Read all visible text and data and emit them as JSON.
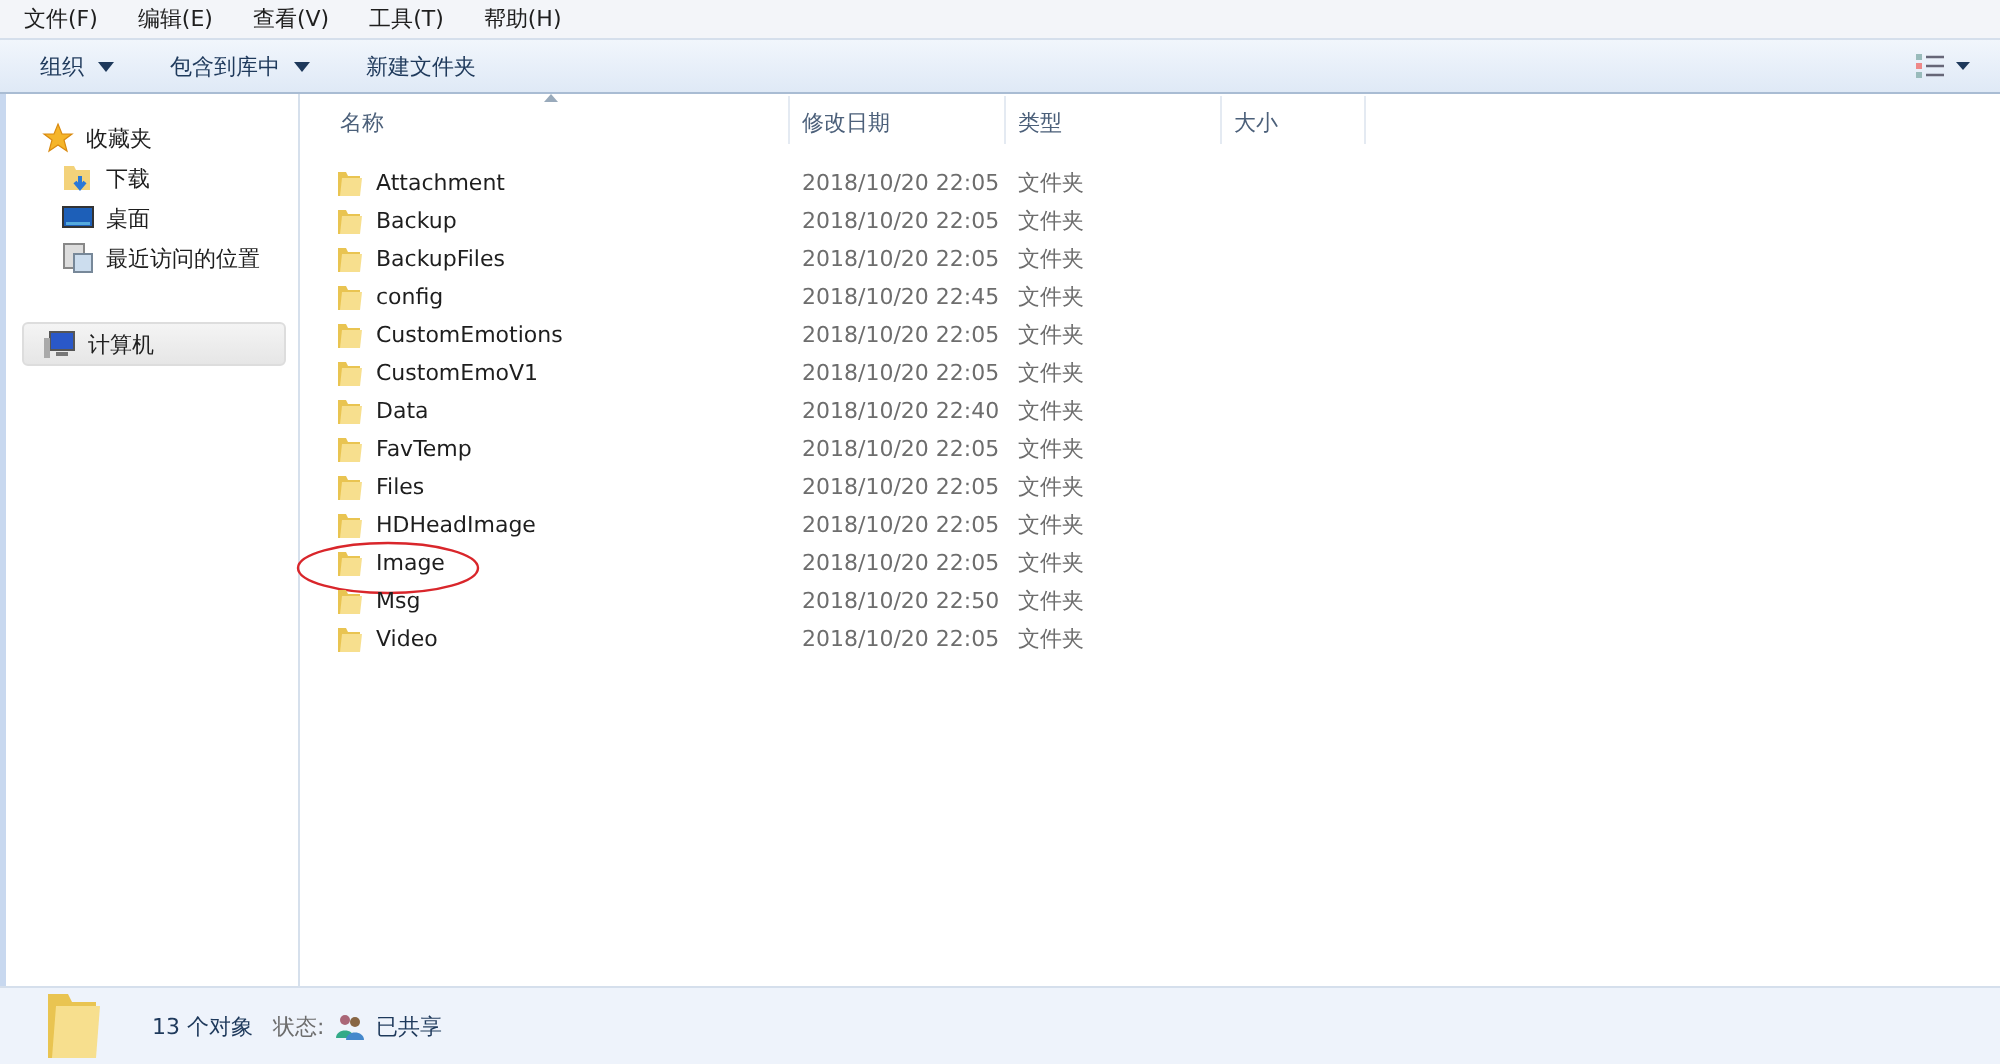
{
  "menu": [
    "文件(F)",
    "编辑(E)",
    "查看(V)",
    "工具(T)",
    "帮助(H)"
  ],
  "toolbar": [
    {
      "label": "组织",
      "dropdown": true
    },
    {
      "label": "包含到库中",
      "dropdown": true
    },
    {
      "label": "新建文件夹",
      "dropdown": false
    }
  ],
  "sidebar": {
    "items": [
      {
        "label": "收藏夹",
        "kind": "favorites",
        "selected": false,
        "children": [
          {
            "label": "下载",
            "kind": "downloads",
            "selected": false
          },
          {
            "label": "桌面",
            "kind": "desktop",
            "selected": false
          },
          {
            "label": "最近访问的位置",
            "kind": "recent",
            "selected": false
          }
        ]
      },
      {
        "label": "计算机",
        "kind": "computer",
        "selected": true
      }
    ]
  },
  "table": {
    "columns": [
      "名称",
      "修改日期",
      "类型",
      "大小"
    ],
    "rows": [
      {
        "name": "Attachment",
        "date": "2018/10/20 22:05",
        "type": "文件夹",
        "circled": false
      },
      {
        "name": "Backup",
        "date": "2018/10/20 22:05",
        "type": "文件夹",
        "circled": false
      },
      {
        "name": "BackupFiles",
        "date": "2018/10/20 22:05",
        "type": "文件夹",
        "circled": false
      },
      {
        "name": "config",
        "date": "2018/10/20 22:45",
        "type": "文件夹",
        "circled": false
      },
      {
        "name": "CustomEmotions",
        "date": "2018/10/20 22:05",
        "type": "文件夹",
        "circled": false
      },
      {
        "name": "CustomEmoV1",
        "date": "2018/10/20 22:05",
        "type": "文件夹",
        "circled": false
      },
      {
        "name": "Data",
        "date": "2018/10/20 22:40",
        "type": "文件夹",
        "circled": false
      },
      {
        "name": "FavTemp",
        "date": "2018/10/20 22:05",
        "type": "文件夹",
        "circled": false
      },
      {
        "name": "Files",
        "date": "2018/10/20 22:05",
        "type": "文件夹",
        "circled": false
      },
      {
        "name": "HDHeadImage",
        "date": "2018/10/20 22:05",
        "type": "文件夹",
        "circled": false
      },
      {
        "name": "Image",
        "date": "2018/10/20 22:05",
        "type": "文件夹",
        "circled": true
      },
      {
        "name": "Msg",
        "date": "2018/10/20 22:50",
        "type": "文件夹",
        "circled": false
      },
      {
        "name": "Video",
        "date": "2018/10/20 22:05",
        "type": "文件夹",
        "circled": false
      }
    ]
  },
  "status_bar": {
    "count": "13 个对象",
    "state_label": "状态:",
    "state": "已共享"
  }
}
